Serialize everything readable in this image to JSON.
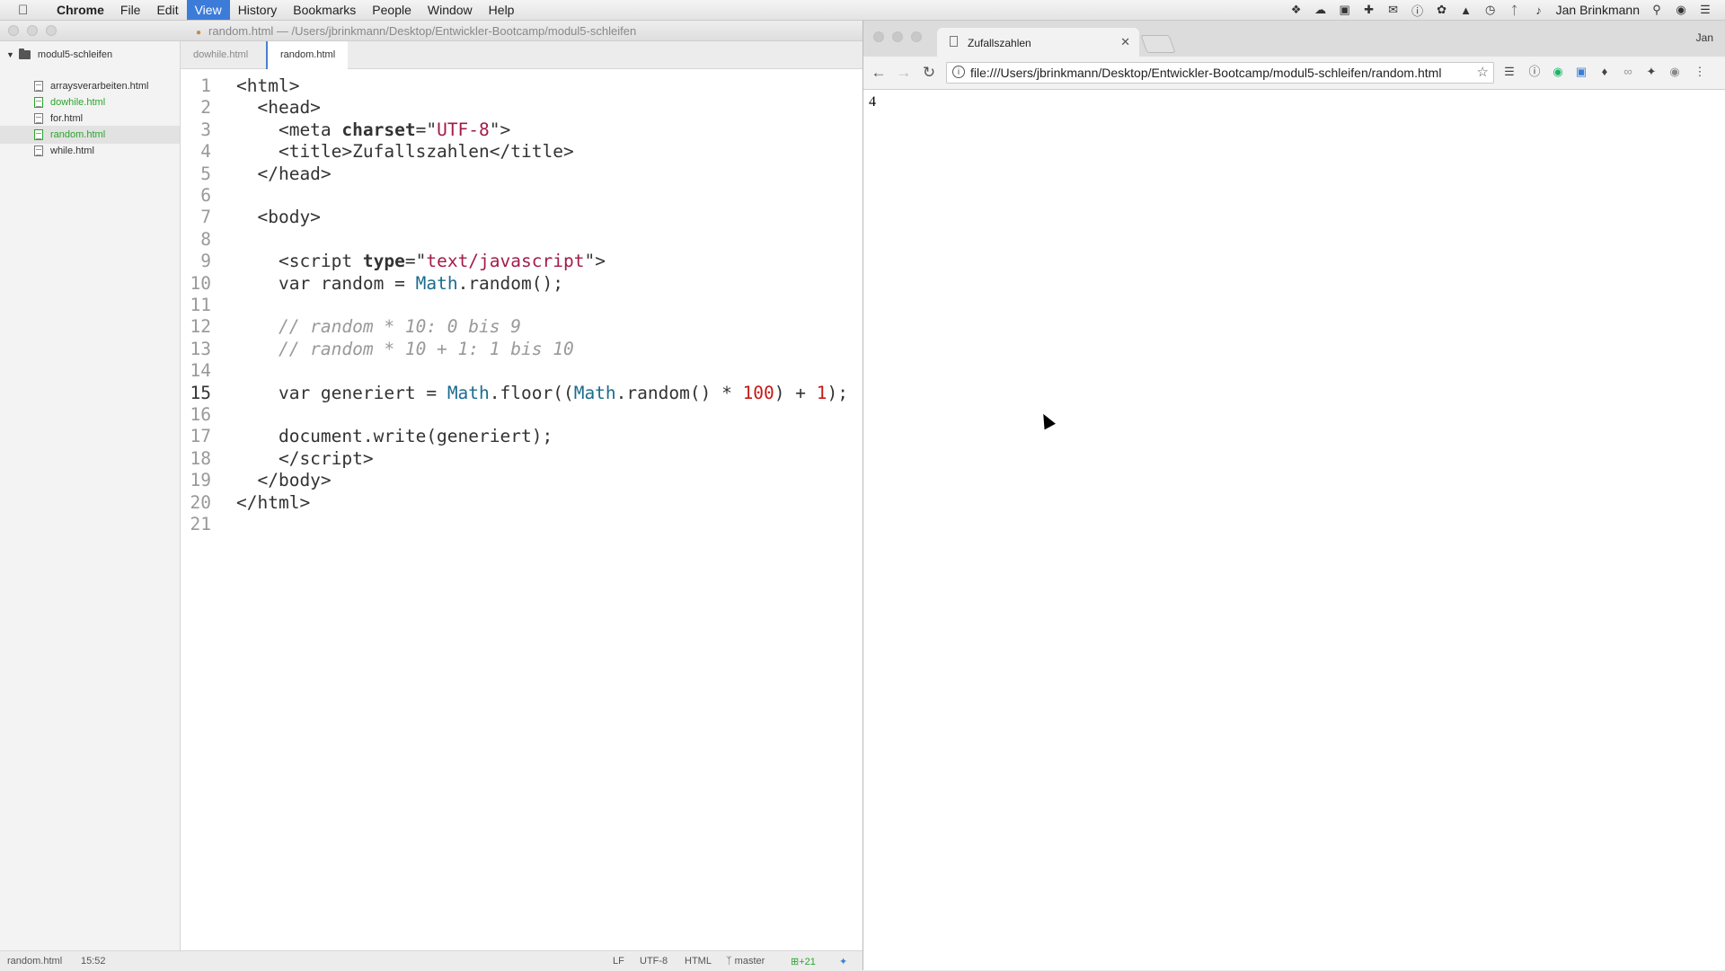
{
  "menubar": {
    "app_name": "Chrome",
    "items": [
      "File",
      "Edit",
      "View",
      "History",
      "Bookmarks",
      "People",
      "Window",
      "Help"
    ],
    "active_item": "View",
    "user_name": "Jan Brinkmann"
  },
  "editor": {
    "window_title": "random.html — /Users/jbrinkmann/Desktop/Entwickler-Bootcamp/modul5-schleifen",
    "tree": {
      "root": "modul5-schleifen",
      "files": [
        {
          "name": "arraysverarbeiten.html",
          "status": "normal"
        },
        {
          "name": "dowhile.html",
          "status": "added"
        },
        {
          "name": "for.html",
          "status": "normal"
        },
        {
          "name": "random.html",
          "status": "added-selected"
        },
        {
          "name": "while.html",
          "status": "normal"
        }
      ]
    },
    "tabs": [
      {
        "label": "dowhile.html",
        "active": false
      },
      {
        "label": "random.html",
        "active": true
      }
    ],
    "current_line": 15,
    "lines": [
      "<html>",
      "  <head>",
      "    <meta charset=\"UTF-8\">",
      "    <title>Zufallszahlen</title>",
      "  </head>",
      "",
      "  <body>",
      "",
      "    <script type=\"text/javascript\">",
      "    var random = Math.random();",
      "",
      "    // random * 10: 0 bis 9",
      "    // random * 10 + 1: 1 bis 10",
      "",
      "    var generiert = Math.floor((Math.random() * 100) + 1);",
      "",
      "    document.write(generiert);",
      "    </script>",
      "  </body>",
      "</html>",
      ""
    ],
    "status": {
      "file": "random.html",
      "cursor": "15:52",
      "line_ending": "LF",
      "encoding": "UTF-8",
      "grammar": "HTML",
      "branch": "master",
      "diff": "+21"
    }
  },
  "browser": {
    "tab_title": "Zufallszahlen",
    "profile": "Jan",
    "url": "file:///Users/jbrinkmann/Desktop/Entwickler-Bootcamp/modul5-schleifen/random.html",
    "page_output": "4"
  }
}
